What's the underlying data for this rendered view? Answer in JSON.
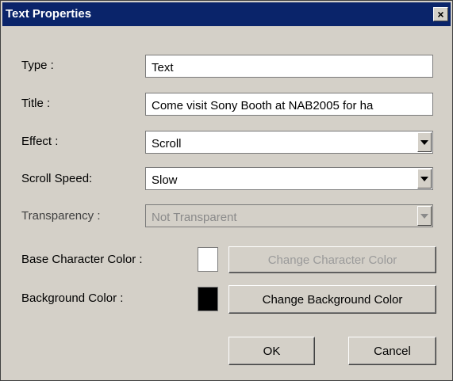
{
  "window": {
    "title": "Text Properties",
    "close_label": "×"
  },
  "form": {
    "type": {
      "label": "Type :",
      "value": "Text"
    },
    "title": {
      "label": "Title :",
      "value": "Come visit Sony Booth at NAB2005 for ha"
    },
    "effect": {
      "label": "Effect :",
      "value": "Scroll"
    },
    "scroll_speed": {
      "label": "Scroll Speed:",
      "value": "Slow"
    },
    "transparency": {
      "label": "Transparency :",
      "value": "Not Transparent"
    },
    "base_char_color": {
      "label": "Base Character Color :",
      "swatch": "#ffffff",
      "button": "Change Character Color"
    },
    "background_color": {
      "label": "Background Color :",
      "swatch": "#000000",
      "button": "Change Background Color"
    }
  },
  "footer": {
    "ok": "OK",
    "cancel": "Cancel"
  }
}
